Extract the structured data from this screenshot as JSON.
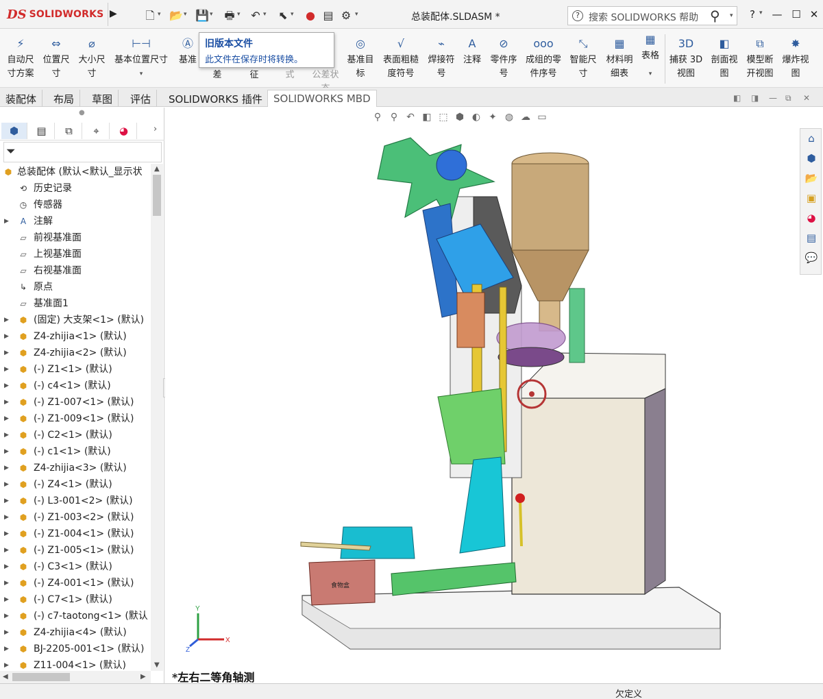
{
  "app": {
    "logo_ds": "DS",
    "logo_text": "SOLIDWORKS",
    "document_title": "总装配体.SLDASM *"
  },
  "search": {
    "placeholder": "搜索 SOLIDWORKS 帮助",
    "help_glyph": "?"
  },
  "window_controls": {
    "help": "?",
    "minimize": "—",
    "maximize": "☐",
    "close": "✕"
  },
  "ribbon": {
    "items": [
      {
        "label": "自动尺寸方案",
        "icon": "auto-dimension-icon"
      },
      {
        "label": "位置尺寸",
        "icon": "location-dimension-icon"
      },
      {
        "label": "大小尺寸",
        "icon": "size-dimension-icon"
      },
      {
        "label": "基本位置尺寸",
        "icon": "basic-location-dimension-icon"
      },
      {
        "label": "基准",
        "icon": "datum-icon"
      },
      {
        "label": "差",
        "icon": "tolerance-icon"
      },
      {
        "label": "征",
        "icon": "feature-icon"
      },
      {
        "label": "式",
        "icon": "pattern-icon"
      },
      {
        "label": "公差状态",
        "icon": "tolerance-status-icon"
      },
      {
        "label": "基准目标",
        "icon": "datum-target-icon"
      },
      {
        "label": "表面粗糙度符号",
        "icon": "surface-finish-icon"
      },
      {
        "label": "焊接符号",
        "icon": "weld-symbol-icon"
      },
      {
        "label": "注释",
        "icon": "note-icon"
      },
      {
        "label": "零件序号",
        "icon": "balloon-icon"
      },
      {
        "label": "成组的零件序号",
        "icon": "stacked-balloon-icon"
      },
      {
        "label": "智能尺寸",
        "icon": "smart-dimension-icon"
      },
      {
        "label": "材料明细表",
        "icon": "bom-icon"
      },
      {
        "label": "表格",
        "icon": "table-icon"
      },
      {
        "label": "捕获 3D 视图",
        "icon": "capture-3d-view-icon"
      },
      {
        "label": "剖面视图",
        "icon": "section-view-icon"
      },
      {
        "label": "模型断开视图",
        "icon": "model-break-view-icon"
      },
      {
        "label": "爆炸视图",
        "icon": "exploded-view-icon"
      }
    ]
  },
  "tooltip": {
    "title": "旧版本文件",
    "body": "此文件在保存时将转换。"
  },
  "tabs": [
    "装配体",
    "布局",
    "草图",
    "评估",
    "SOLIDWORKS 插件",
    "SOLIDWORKS MBD"
  ],
  "tree": {
    "root": "总装配体  (默认<默认_显示状",
    "items": [
      {
        "label": "历史记录",
        "expandable": false,
        "icon": "history-icon"
      },
      {
        "label": "传感器",
        "expandable": false,
        "icon": "sensor-icon"
      },
      {
        "label": "注解",
        "expandable": true,
        "icon": "annotation-icon"
      },
      {
        "label": "前视基准面",
        "expandable": false,
        "icon": "plane-icon"
      },
      {
        "label": "上视基准面",
        "expandable": false,
        "icon": "plane-icon"
      },
      {
        "label": "右视基准面",
        "expandable": false,
        "icon": "plane-icon"
      },
      {
        "label": "原点",
        "expandable": false,
        "icon": "origin-icon"
      },
      {
        "label": "基准面1",
        "expandable": false,
        "icon": "plane-icon"
      },
      {
        "label": "(固定) 大支架<1> (默认)",
        "expandable": true,
        "icon": "part-icon"
      },
      {
        "label": "Z4-zhijia<1> (默认)",
        "expandable": true,
        "icon": "part-icon"
      },
      {
        "label": "Z4-zhijia<2> (默认)",
        "expandable": true,
        "icon": "part-icon"
      },
      {
        "label": "(-) Z1<1> (默认)",
        "expandable": true,
        "icon": "part-icon"
      },
      {
        "label": "(-) c4<1> (默认)",
        "expandable": true,
        "icon": "part-icon"
      },
      {
        "label": "(-) Z1-007<1> (默认)",
        "expandable": true,
        "icon": "part-icon"
      },
      {
        "label": "(-) Z1-009<1> (默认)",
        "expandable": true,
        "icon": "part-icon"
      },
      {
        "label": "(-) C2<1> (默认)",
        "expandable": true,
        "icon": "part-icon"
      },
      {
        "label": "(-) c1<1> (默认)",
        "expandable": true,
        "icon": "part-icon"
      },
      {
        "label": "Z4-zhijia<3> (默认)",
        "expandable": true,
        "icon": "part-icon"
      },
      {
        "label": "(-) Z4<1> (默认)",
        "expandable": true,
        "icon": "part-icon"
      },
      {
        "label": "(-) L3-001<2> (默认)",
        "expandable": true,
        "icon": "part-icon"
      },
      {
        "label": "(-) Z1-003<2> (默认)",
        "expandable": true,
        "icon": "part-icon"
      },
      {
        "label": "(-) Z1-004<1> (默认)",
        "expandable": true,
        "icon": "part-icon"
      },
      {
        "label": "(-) Z1-005<1> (默认)",
        "expandable": true,
        "icon": "part-icon"
      },
      {
        "label": "(-) C3<1> (默认)",
        "expandable": true,
        "icon": "part-icon"
      },
      {
        "label": "(-) Z4-001<1> (默认)",
        "expandable": true,
        "icon": "part-icon"
      },
      {
        "label": "(-) C7<1> (默认)",
        "expandable": true,
        "icon": "part-icon"
      },
      {
        "label": "(-) c7-taotong<1> (默认",
        "expandable": true,
        "icon": "part-icon"
      },
      {
        "label": "Z4-zhijia<4> (默认)",
        "expandable": true,
        "icon": "part-icon"
      },
      {
        "label": "BJ-2205-001<1> (默认)",
        "expandable": true,
        "icon": "part-icon"
      },
      {
        "label": "Z11-004<1> (默认)",
        "expandable": true,
        "icon": "part-icon"
      }
    ]
  },
  "viewport": {
    "view_label": "*左右二等角轴测",
    "triad": {
      "x": "X",
      "y": "Y",
      "z": "Z"
    },
    "box_text": "食物盒"
  },
  "status": {
    "text": "欠定义"
  },
  "colors": {
    "accent_blue": "#2f5d9e",
    "frame_green": "#55c46a",
    "hopper_tan": "#c8a97a",
    "body_beige": "#e9e4d6",
    "chute_cyan": "#17c9d9",
    "tooltip_blue": "#1a4ea3",
    "logo_red": "#d12b2b"
  }
}
